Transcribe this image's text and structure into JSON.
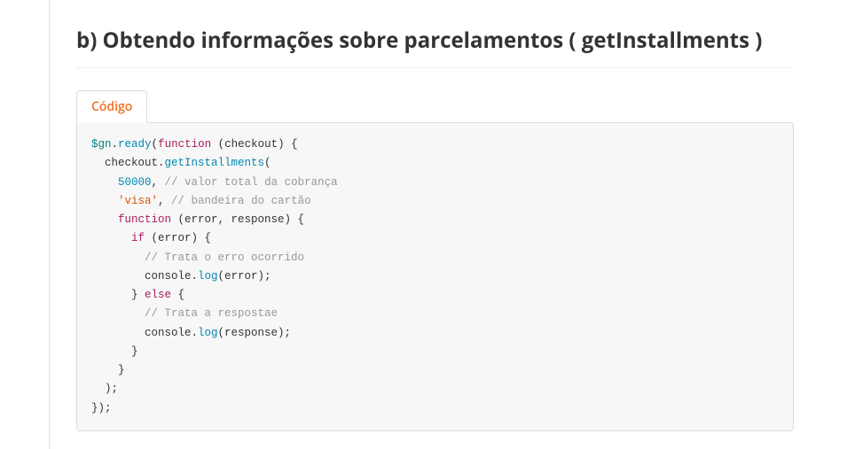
{
  "section": {
    "title": "b) Obtendo informações sobre parcelamentos ( getInstallments )"
  },
  "tabs": {
    "code_label": "Código"
  },
  "code": {
    "line1_var": "$gn",
    "line1_dot": ".",
    "line1_method": "ready",
    "line1_open": "(",
    "line1_kw": "function",
    "line1_rest": " (checkout) {",
    "line2": "",
    "line3_indent": "  checkout.",
    "line3_method": "getInstallments",
    "line3_open": "(",
    "line4_indent": "    ",
    "line4_num": "50000",
    "line4_comma": ",",
    "line4_comment": " // valor total da cobrança",
    "line5_indent": "    ",
    "line5_str": "'visa'",
    "line5_comma": ",",
    "line5_comment": " // bandeira do cartão",
    "line6_indent": "    ",
    "line6_kw": "function",
    "line6_rest": " (error, response) {",
    "line7_indent": "      ",
    "line7_kw": "if",
    "line7_rest": " (error) {",
    "line8_indent": "        ",
    "line8_comment": "// Trata o erro ocorrido",
    "line9_indent": "        console.",
    "line9_method": "log",
    "line9_rest": "(error);",
    "line10_indent": "      } ",
    "line10_kw": "else",
    "line10_rest": " {",
    "line11_indent": "        ",
    "line11_comment": "// Trata a respostae",
    "line12_indent": "        console.",
    "line12_method": "log",
    "line12_rest": "(response);",
    "line13": "      }",
    "line14": "    }",
    "line15": "  );",
    "line16": "",
    "line17": "});"
  }
}
